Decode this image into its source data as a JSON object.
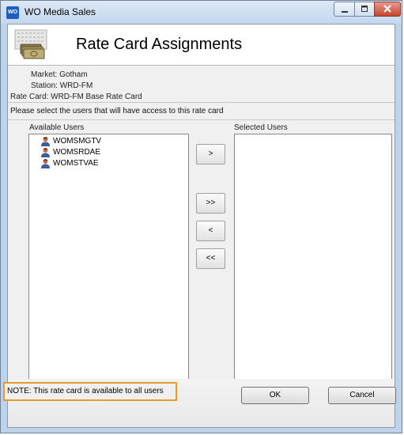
{
  "window": {
    "app_icon": "WO",
    "title": "WO Media Sales",
    "controls": [
      "minimize-icon",
      "maximize-icon",
      "close-icon"
    ]
  },
  "header": {
    "icon": "money-stack-icon",
    "title": "Rate Card Assignments"
  },
  "info": {
    "market": "Market: Gotham",
    "station": "Station: WRD-FM",
    "rate_card": "Rate Card: WRD-FM Base Rate Card"
  },
  "instruction": "Please select the users that will have access to this rate card",
  "available": {
    "label": "Available Users",
    "items": [
      {
        "name": "WOMSMGTV",
        "icon": "user-icon"
      },
      {
        "name": "WOMSRDAE",
        "icon": "user-icon"
      },
      {
        "name": "WOMSTVAE",
        "icon": "user-icon"
      }
    ]
  },
  "selected": {
    "label": "Selected Users",
    "items": []
  },
  "move_buttons": {
    "add": ">",
    "add_all": ">>",
    "remove": "<",
    "remove_all": "<<"
  },
  "footer": {
    "note": "NOTE: This rate card is available to all users",
    "ok": "OK",
    "cancel": "Cancel"
  },
  "colors": {
    "note_border": "#e69a2d",
    "titlebar": "#c3d7ee",
    "close_button": "#c7442d"
  }
}
